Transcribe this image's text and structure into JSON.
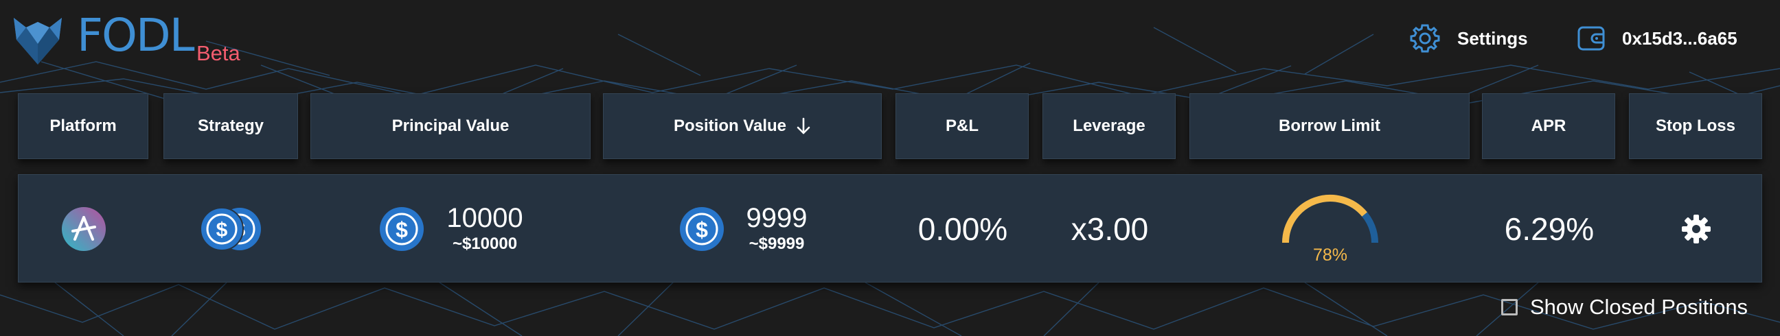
{
  "app": {
    "brand": "FODL",
    "badge": "Beta"
  },
  "nav": {
    "settings_label": "Settings",
    "wallet_address": "0x15d3...6a65"
  },
  "table": {
    "headers": [
      "Platform",
      "Strategy",
      "Principal Value",
      "Position Value",
      "P&L",
      "Leverage",
      "Borrow Limit",
      "APR",
      "Stop Loss"
    ],
    "sort_indicator": "↓",
    "rows": [
      {
        "platform_icon": "aave-icon",
        "strategy_icons": [
          "usdc-icon",
          "usdc-icon"
        ],
        "principal": {
          "amount": "10000",
          "usd": "~$10000"
        },
        "position": {
          "amount": "9999",
          "usd": "~$9999"
        },
        "pnl": "0.00%",
        "leverage": "x3.00",
        "borrow_limit": {
          "label": "78%",
          "value": 0.78
        },
        "apr": "6.29%",
        "stop_loss_icon": "gear-icon"
      }
    ]
  },
  "footer": {
    "show_closed_label": "Show Closed Positions",
    "show_closed_checked": false
  },
  "colors": {
    "background": "#1c1c1c",
    "panel": "#253240",
    "brand": "#3f8fd4",
    "beta": "#f45d6f",
    "gauge": "#f5b94a",
    "gauge_track": "#1f5f9a",
    "usdc": "#2775ca"
  }
}
